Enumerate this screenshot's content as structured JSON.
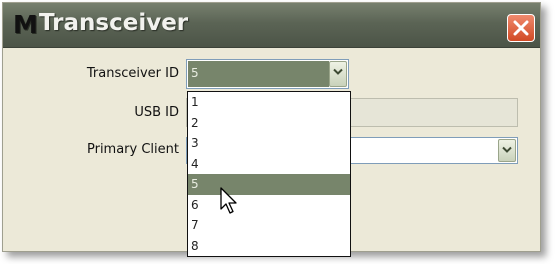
{
  "window": {
    "logo_letter": "M",
    "title": "Transceiver"
  },
  "form": {
    "transceiver_id": {
      "label": "Transceiver ID",
      "value": "5"
    },
    "usb_id": {
      "label": "USB ID",
      "value": ""
    },
    "primary_client": {
      "label": "Primary Client",
      "value": ""
    }
  },
  "dropdown": {
    "options": [
      "1",
      "2",
      "3",
      "4",
      "5",
      "6",
      "7",
      "8"
    ],
    "selected": "5"
  },
  "colors": {
    "titlebar": "#5b6455",
    "selection": "#77856b",
    "close_button": "#d14a25",
    "window_bg": "#ece9d8"
  },
  "icons": {
    "close": "close-icon",
    "dropdown_arrow": "chevron-down-icon",
    "cursor": "mouse-pointer-icon"
  }
}
